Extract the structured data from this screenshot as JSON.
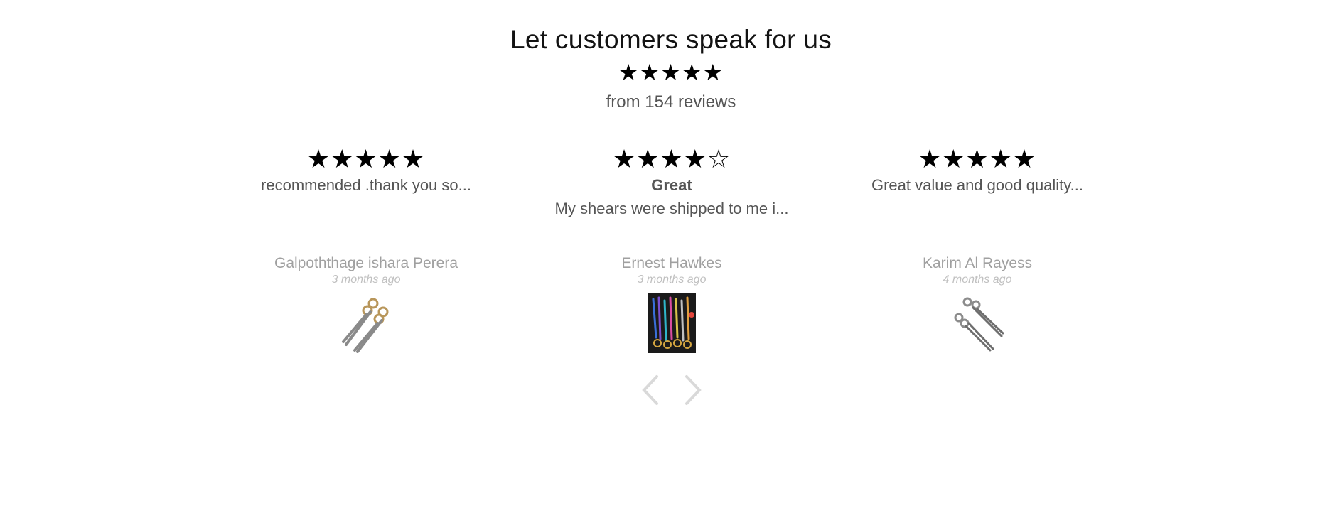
{
  "header": {
    "title": "Let customers speak for us",
    "summary_stars": "★★★★★",
    "summary_count": "from 154 reviews",
    "rating": 5
  },
  "reviews": [
    {
      "stars": "★★★★★",
      "rating": 5,
      "title": "",
      "body": "recommended .thank you so...",
      "reviewer": "Galpoththage ishara Perera",
      "date": "3 months ago",
      "photo_icon": "gold-scissors-icon"
    },
    {
      "stars": "★★★★☆",
      "rating": 4,
      "title": "Great",
      "body": "My shears were shipped to me i...",
      "reviewer": "Ernest Hawkes",
      "date": "3 months ago",
      "photo_icon": "colorful-shears-photo"
    },
    {
      "stars": "★★★★★",
      "rating": 5,
      "title": "",
      "body": "Great value and good quality...",
      "reviewer": "Karim Al Rayess",
      "date": "4 months ago",
      "photo_icon": "silver-scissors-icon"
    }
  ],
  "navigation": {
    "prev_icon": "chevron-left-icon",
    "next_icon": "chevron-right-icon"
  },
  "colors": {
    "heading": "#121212",
    "text": "#555555",
    "muted": "#a0a0a0",
    "arrow": "#d9d9d9",
    "star": "#000000"
  }
}
